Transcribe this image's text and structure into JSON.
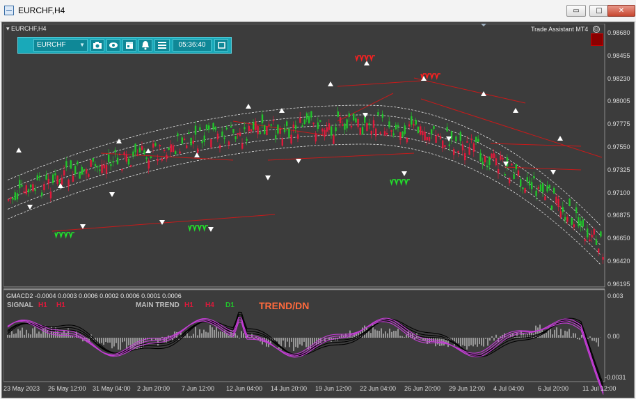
{
  "window": {
    "title": "EURCHF,H4",
    "minimize_glyph": "▭",
    "maximize_glyph": "□",
    "close_glyph": "✕"
  },
  "chart": {
    "symbol_label": "EURCHF,H4",
    "assistant_label": "Trade Assistant MT4",
    "assistant_icon_glyph": "☺"
  },
  "toolbar": {
    "symbol": "EURCHF",
    "dropdown_glyph": "▼",
    "time": "05:36:40",
    "icons": [
      "camera-icon",
      "eye-icon",
      "calendar-icon",
      "alert-bell-icon",
      "menu-icon",
      "window-icon"
    ]
  },
  "colors": {
    "background": "#3c3c3c",
    "bull_candle": "#21c42b",
    "bear_candle": "#e0193b",
    "envelope": "#ffffff",
    "trendline": "#c81a1a",
    "signal_line": "#c43cd6",
    "macd_line": "#000000"
  },
  "price_axis": [
    "0.98680",
    "0.98455",
    "0.98230",
    "0.98005",
    "0.97775",
    "0.97550",
    "0.97325",
    "0.97100",
    "0.96875",
    "0.96650",
    "0.96420",
    "0.96195"
  ],
  "indicator": {
    "header": "GMACD2 -0.0004 0.0003 0.0006 0.0002 0.0006 0.0001 0.0006",
    "signal_label": "SIGNAL",
    "signal_h1": "H1",
    "signal_h1b": "H1",
    "main_trend_label": "MAIN TREND",
    "mt_h1": "H1",
    "mt_h4": "H4",
    "mt_d1": "D1",
    "trend_text": "TREND/DN",
    "axis": [
      "0.003",
      "0.00",
      "-0.0031"
    ]
  },
  "time_axis": [
    "23 May 2023",
    "26 May 12:00",
    "31 May 04:00",
    "2 Jun 20:00",
    "7 Jun 12:00",
    "12 Jun 04:00",
    "14 Jun 20:00",
    "19 Jun 12:00",
    "22 Jun 04:00",
    "26 Jun 20:00",
    "29 Jun 12:00",
    "4 Jul 04:00",
    "6 Jul 20:00",
    "11 Jul 12:00"
  ]
}
